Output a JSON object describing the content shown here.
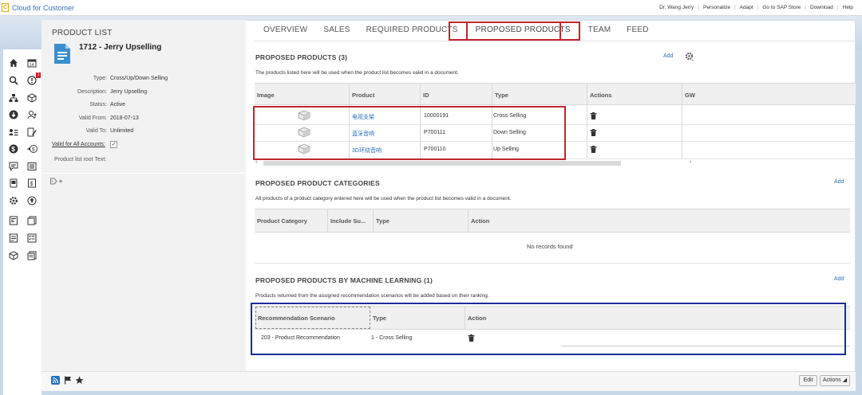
{
  "app": {
    "logo_glyph": "C",
    "title": "Cloud for Customer"
  },
  "toplinks": [
    "Dr. Wang Jerry",
    "Personalize",
    "Adapt",
    "Go to SAP Store",
    "Download",
    "Help"
  ],
  "rail": {
    "badge_count": "1"
  },
  "header": {
    "section": "PRODUCT LIST",
    "title": "1712 - Jerry Upselling",
    "fields": [
      {
        "label": "Type:",
        "value": "Cross/Up/Down Selling"
      },
      {
        "label": "Description:",
        "value": "Jerry Upselling"
      },
      {
        "label": "Status:",
        "value": "Active"
      },
      {
        "label": "Valid From:",
        "value": "2018-07-13"
      },
      {
        "label": "Valid To:",
        "value": "Unlimited"
      }
    ],
    "valid_all_label": "Valid for All Accounts:",
    "valid_all_checked": "✓",
    "root_text_label": "Product list root Text:"
  },
  "tabs": [
    "OVERVIEW",
    "SALES",
    "REQUIRED PRODUCTS",
    "PROPOSED PRODUCTS",
    "TEAM",
    "FEED"
  ],
  "active_tab": "PROPOSED PRODUCTS",
  "proposed": {
    "title": "PROPOSED PRODUCTS (3)",
    "add": "Add",
    "desc": "The products listed here will be used when the product list becomes valid in a document.",
    "columns": [
      "Image",
      "Product",
      "ID",
      "Type",
      "Actions",
      "GW"
    ],
    "rows": [
      {
        "product": "电视支架",
        "id": "10000191",
        "type": "Cross Selling"
      },
      {
        "product": "蓝牙音响",
        "id": "P700111",
        "type": "Down Selling"
      },
      {
        "product": "3D环绕音响",
        "id": "P700110",
        "type": "Up Selling"
      }
    ]
  },
  "categories": {
    "title": "PROPOSED PRODUCT CATEGORIES",
    "add": "Add",
    "desc": "All products of a product category entered here will be used when the product list becomes valid in a document.",
    "columns": [
      "Product Category",
      "Include Su...",
      "Type",
      "Action"
    ],
    "empty": "No records found"
  },
  "ml": {
    "title": "PROPOSED PRODUCTS BY MACHINE LEARNING (1)",
    "add": "Add",
    "desc": "Products returned from the assigned recommendation scenarios will be added based on their ranking.",
    "columns": [
      "Recommendation Scenario",
      "Type",
      "Action"
    ],
    "rows": [
      {
        "scenario": "203 - Product Recommendation",
        "type": "1 - Cross Selling"
      }
    ]
  },
  "footer": {
    "edit": "Edit",
    "actions": "Actions"
  },
  "colors": {
    "accent_blue": "#2a6ebb",
    "highlight_red": "#c0262c",
    "highlight_navy": "#1c2b9b"
  }
}
